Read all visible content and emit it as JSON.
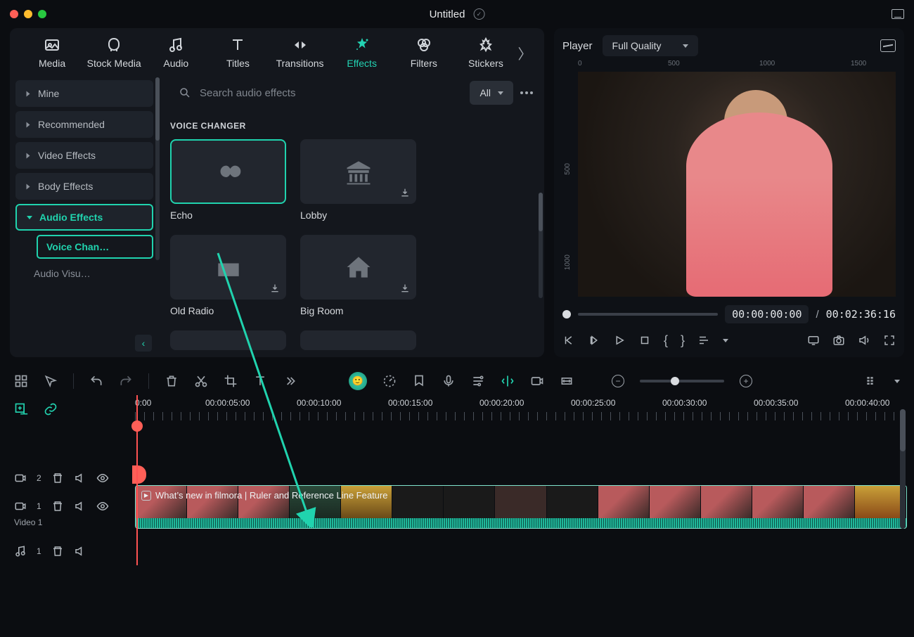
{
  "titlebar": {
    "title": "Untitled"
  },
  "tabs": {
    "items": [
      "Media",
      "Stock Media",
      "Audio",
      "Titles",
      "Transitions",
      "Effects",
      "Filters",
      "Stickers"
    ],
    "active_index": 5
  },
  "sidebar": {
    "items": [
      "Mine",
      "Recommended",
      "Video Effects",
      "Body Effects",
      "Audio Effects"
    ],
    "active_index": 4,
    "sub_active": "Voice Chan…",
    "sub_plain": "Audio Visu…"
  },
  "search": {
    "placeholder": "Search audio effects"
  },
  "filter": {
    "label": "All"
  },
  "section": {
    "title": "VOICE CHANGER"
  },
  "effects": [
    {
      "name": "Echo",
      "selected": true,
      "download": false
    },
    {
      "name": "Lobby",
      "selected": false,
      "download": true
    },
    {
      "name": "Old Radio",
      "selected": false,
      "download": true
    },
    {
      "name": "Big Room",
      "selected": false,
      "download": true
    }
  ],
  "player": {
    "label": "Player",
    "quality": "Full Quality",
    "ruler_h": [
      "0",
      "500",
      "1000",
      "1500"
    ],
    "ruler_v": [
      "500",
      "1000"
    ],
    "current": "00:00:00:00",
    "sep": "/",
    "duration": "00:02:36:16"
  },
  "timeline": {
    "ruler": [
      "0:00",
      "00:00:05:00",
      "00:00:10:00",
      "00:00:15:00",
      "00:00:20:00",
      "00:00:25:00",
      "00:00:30:00",
      "00:00:35:00",
      "00:00:40:00"
    ],
    "track2_count": "2",
    "track1_count": "1",
    "video_label": "Video 1",
    "audio_count": "1",
    "clip_label": "What’s new in filmora | Ruler and Reference Line Feature"
  }
}
